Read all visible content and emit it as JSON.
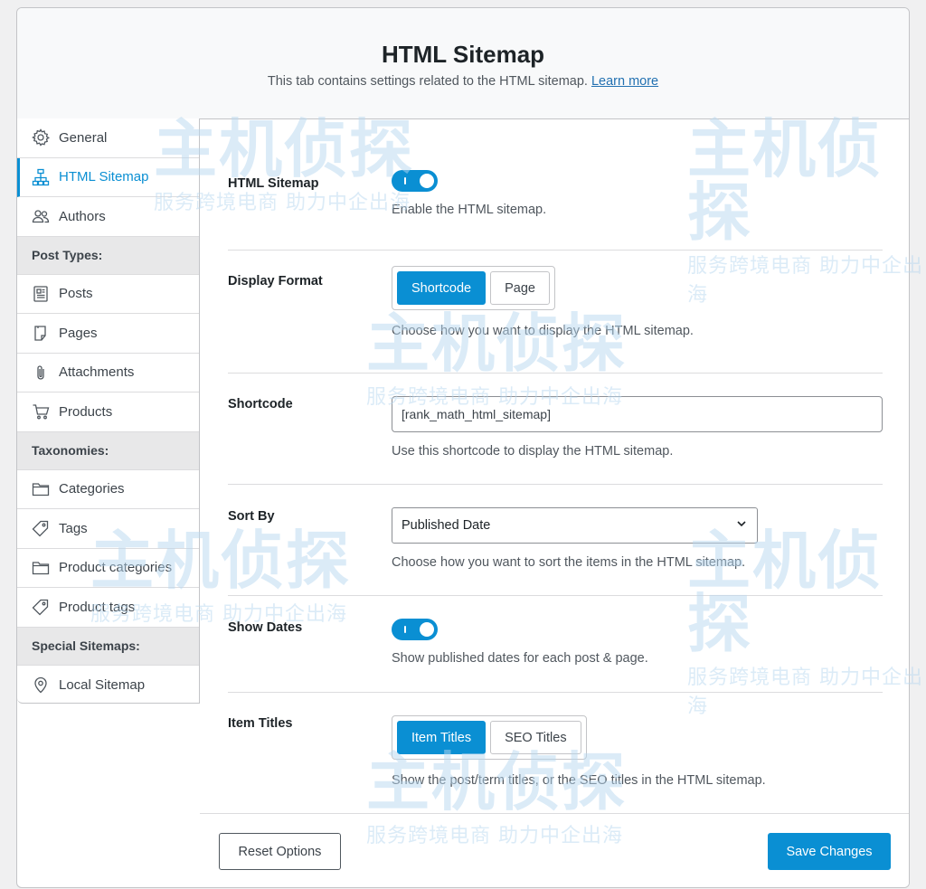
{
  "header": {
    "title": "HTML Sitemap",
    "description": "This tab contains settings related to the HTML sitemap.",
    "learn_more": "Learn more"
  },
  "sidebar": {
    "items_top": [
      {
        "label": "General",
        "icon": "gear-icon"
      },
      {
        "label": "HTML Sitemap",
        "icon": "sitemap-icon",
        "active": true
      },
      {
        "label": "Authors",
        "icon": "users-icon"
      }
    ],
    "post_types_heading": "Post Types:",
    "post_types": [
      {
        "label": "Posts",
        "icon": "document-icon"
      },
      {
        "label": "Pages",
        "icon": "pages-icon"
      },
      {
        "label": "Attachments",
        "icon": "paperclip-icon"
      },
      {
        "label": "Products",
        "icon": "cart-icon"
      }
    ],
    "taxonomies_heading": "Taxonomies:",
    "taxonomies": [
      {
        "label": "Categories",
        "icon": "folder-icon"
      },
      {
        "label": "Tags",
        "icon": "tag-icon"
      },
      {
        "label": "Product categories",
        "icon": "folder-icon"
      },
      {
        "label": "Product tags",
        "icon": "tag-icon"
      }
    ],
    "special_heading": "Special Sitemaps:",
    "special": [
      {
        "label": "Local Sitemap",
        "icon": "location-pin-icon"
      }
    ]
  },
  "settings": {
    "html_sitemap": {
      "label": "HTML Sitemap",
      "enabled": true,
      "description": "Enable the HTML sitemap."
    },
    "display_format": {
      "label": "Display Format",
      "options": [
        "Shortcode",
        "Page"
      ],
      "selected": "Shortcode",
      "description": "Choose how you want to display the HTML sitemap."
    },
    "shortcode": {
      "label": "Shortcode",
      "value": "[rank_math_html_sitemap]",
      "description": "Use this shortcode to display the HTML sitemap."
    },
    "sort_by": {
      "label": "Sort By",
      "value": "Published Date",
      "description": "Choose how you want to sort the items in the HTML sitemap."
    },
    "show_dates": {
      "label": "Show Dates",
      "enabled": true,
      "description": "Show published dates for each post & page."
    },
    "item_titles": {
      "label": "Item Titles",
      "options": [
        "Item Titles",
        "SEO Titles"
      ],
      "selected": "Item Titles",
      "description": "Show the post/term titles, or the SEO titles in the HTML sitemap."
    }
  },
  "footer": {
    "reset_label": "Reset Options",
    "save_label": "Save Changes"
  },
  "watermark": {
    "logo_text": "主机侦探",
    "sub_text": "服务跨境电商 助力中企出海"
  },
  "colors": {
    "accent": "#0a8fd3",
    "border": "#c3c4c7"
  }
}
